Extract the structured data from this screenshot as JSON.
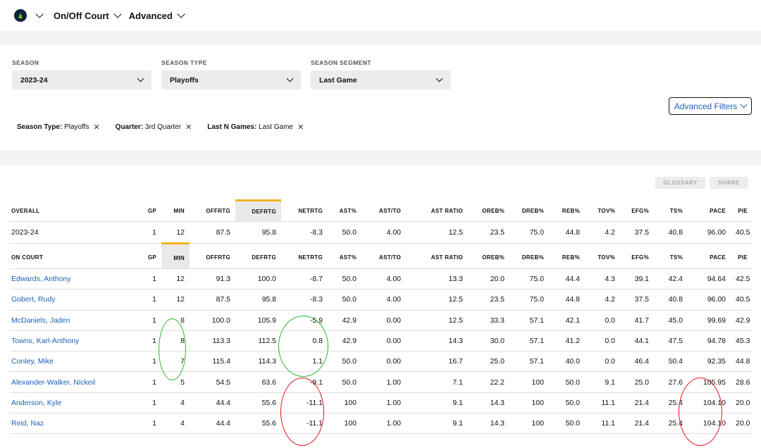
{
  "nav": {
    "court": "On/Off Court",
    "measure": "Advanced"
  },
  "filters": [
    {
      "label": "SEASON",
      "value": "2023-24"
    },
    {
      "label": "SEASON TYPE",
      "value": "Playoffs"
    },
    {
      "label": "SEASON SEGMENT",
      "value": "Last Game"
    }
  ],
  "advanced_filters_label": "Advanced Filters",
  "chips": [
    {
      "key": "Season Type:",
      "value": "Playoffs"
    },
    {
      "key": "Quarter:",
      "value": "3rd Quarter"
    },
    {
      "key": "Last N Games:",
      "value": "Last Game"
    }
  ],
  "chip_close": "✕",
  "buttons": {
    "glossary": "GLOSSARY",
    "share": "SHARE"
  },
  "overall": {
    "header": [
      "OVERALL",
      "GP",
      "MIN",
      "OFFRTG",
      "DEFRTG",
      "NETRTG",
      "AST%",
      "AST/TO",
      "AST RATIO",
      "OREB%",
      "DREB%",
      "REB%",
      "TOV%",
      "EFG%",
      "TS%",
      "PACE",
      "PIE"
    ],
    "row": [
      "2023-24",
      "1",
      "12",
      "87.5",
      "95.8",
      "-8.3",
      "50.0",
      "4.00",
      "12.5",
      "23.5",
      "75.0",
      "44.8",
      "4.2",
      "37.5",
      "40.8",
      "96.00",
      "40.5"
    ]
  },
  "on_court": {
    "header": [
      "ON COURT",
      "GP",
      "MIN",
      "OFFRTG",
      "DEFRTG",
      "NETRTG",
      "AST%",
      "AST/TO",
      "AST RATIO",
      "OREB%",
      "DREB%",
      "REB%",
      "TOV%",
      "EFG%",
      "TS%",
      "PACE",
      "PIE"
    ],
    "rows": [
      [
        "Edwards, Anthony",
        "1",
        "12",
        "91.3",
        "100.0",
        "-8.7",
        "50.0",
        "4.00",
        "13.3",
        "20.0",
        "75.0",
        "44.4",
        "4.3",
        "39.1",
        "42.4",
        "94.64",
        "42.5"
      ],
      [
        "Gobert, Rudy",
        "1",
        "12",
        "87.5",
        "95.8",
        "-8.3",
        "50.0",
        "4.00",
        "12.5",
        "23.5",
        "75.0",
        "44.8",
        "4.2",
        "37.5",
        "40.8",
        "96.00",
        "40.5"
      ],
      [
        "McDaniels, Jaden",
        "1",
        "8",
        "100.0",
        "105.9",
        "-5.9",
        "42.9",
        "0.00",
        "12.5",
        "33.3",
        "57.1",
        "42.1",
        "0.0",
        "41.7",
        "45.0",
        "99.69",
        "42.9"
      ],
      [
        "Towns, Karl-Anthony",
        "1",
        "8",
        "113.3",
        "112.5",
        "0.8",
        "42.9",
        "0.00",
        "14.3",
        "30.0",
        "57.1",
        "41.2",
        "0.0",
        "44.1",
        "47.5",
        "94.78",
        "45.3"
      ],
      [
        "Conley, Mike",
        "1",
        "7",
        "115.4",
        "114.3",
        "1.1",
        "50.0",
        "0.00",
        "16.7",
        "25.0",
        "57.1",
        "40.0",
        "0.0",
        "46.4",
        "50.4",
        "92.35",
        "44.8"
      ],
      [
        "Alexander-Walker, Nickeil",
        "1",
        "5",
        "54.5",
        "63.6",
        "-9.1",
        "50.0",
        "1.00",
        "7.1",
        "22.2",
        "100",
        "50.0",
        "9.1",
        "25.0",
        "27.6",
        "105.95",
        "28.6"
      ],
      [
        "Anderson, Kyle",
        "1",
        "4",
        "44.4",
        "55.6",
        "-11.1",
        "100",
        "1.00",
        "9.1",
        "14.3",
        "100",
        "50.0",
        "11.1",
        "21.4",
        "25.4",
        "104.10",
        "20.0"
      ],
      [
        "Reid, Naz",
        "1",
        "4",
        "44.4",
        "55.6",
        "-11.1",
        "100",
        "1.00",
        "9.1",
        "14.3",
        "100",
        "50.0",
        "11.1",
        "21.4",
        "25.4",
        "104.10",
        "20.0"
      ]
    ]
  },
  "colors": {
    "link": "#1d5fb8",
    "sort_accent": "#f2b11b",
    "annotation_green": "#2db52d",
    "annotation_red": "#e0141e"
  }
}
